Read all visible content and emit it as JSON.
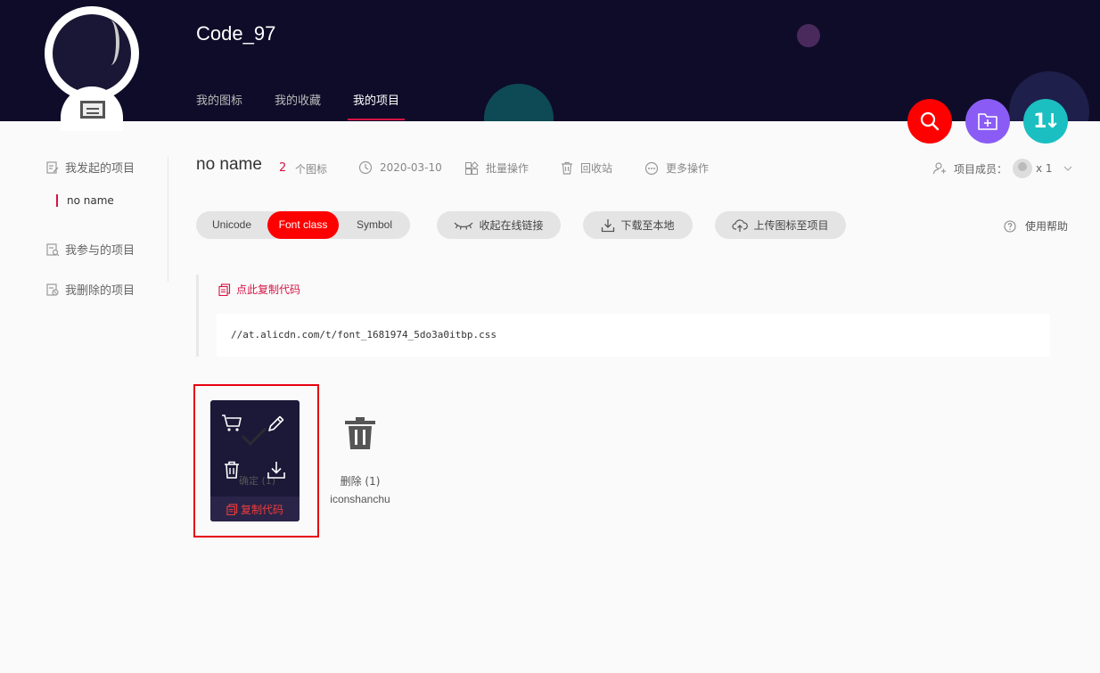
{
  "header": {
    "username": "Code_97",
    "tabs": [
      {
        "label": "我的图标"
      },
      {
        "label": "我的收藏"
      },
      {
        "label": "我的项目"
      }
    ],
    "background": "#0f0c29",
    "active_tab_underline": "#d71345"
  },
  "round_buttons": {
    "search": {
      "icon": "search-icon",
      "color": "#ff0000"
    },
    "add_project": {
      "icon": "folder-add-icon",
      "color": "#8a5cf5"
    },
    "sort": {
      "icon": "sort-icon",
      "color": "#1bbfc1",
      "glyph": "1↓"
    }
  },
  "sidebar": {
    "sections": [
      {
        "label": "我发起的项目"
      },
      {
        "label": "我参与的项目"
      },
      {
        "label": "我删除的项目"
      }
    ],
    "active_project": "no name"
  },
  "project": {
    "name": "no name",
    "icon_count": "2",
    "icon_count_label": "个图标",
    "date": "2020-03-10",
    "batch_label": "批量操作",
    "recycle_label": "回收站",
    "more_label": "更多操作",
    "members_label": "项目成员：",
    "members_count": "x 1"
  },
  "toolbar": {
    "modes": [
      {
        "label": "Unicode"
      },
      {
        "label": "Font class"
      },
      {
        "label": "Symbol"
      }
    ],
    "active_mode": "Font class",
    "collapse_link_label": "收起在线链接",
    "download_label": "下载至本地",
    "upload_label": "上传图标至项目",
    "help_label": "使用帮助"
  },
  "code_panel": {
    "copy_label": "点此复制代码",
    "code": "//at.alicdn.com/t/font_1681974_5do3a0itbp.css"
  },
  "icons": [
    {
      "hover": true,
      "ghost_label": "确定 (1)",
      "copy_code_label": "复制代码"
    },
    {
      "name": "删除 (1)",
      "code": "iconshanchu"
    }
  ],
  "accent_color": "#d71345"
}
